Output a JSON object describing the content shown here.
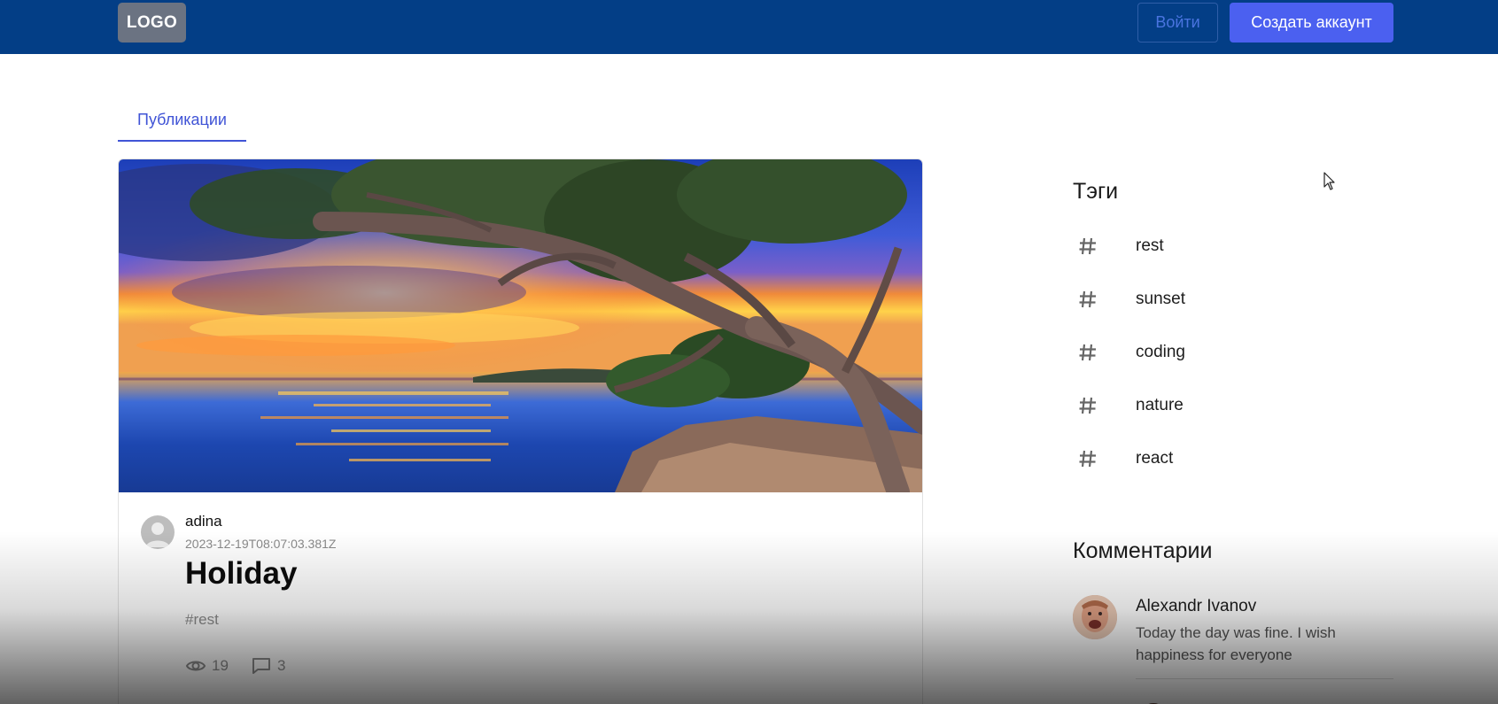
{
  "header": {
    "logo": "LOGO",
    "login_label": "Войти",
    "signup_label": "Создать аккаунт"
  },
  "tabs": [
    {
      "label": "Публикации",
      "active": true
    }
  ],
  "post": {
    "author": "adina",
    "date": "2023-12-19T08:07:03.381Z",
    "title": "Holiday",
    "tag": "#rest",
    "views": "19",
    "comments": "3"
  },
  "sidebar": {
    "tags_title": "Тэги",
    "tags": [
      {
        "label": "rest",
        "icon": "hash-icon"
      },
      {
        "label": "sunset",
        "icon": "hash-icon"
      },
      {
        "label": "coding",
        "icon": "hash-icon"
      },
      {
        "label": "nature",
        "icon": "hash-icon"
      },
      {
        "label": "react",
        "icon": "hash-icon"
      }
    ],
    "comments_title": "Комментарии",
    "comments": [
      {
        "name": "Alexandr Ivanov",
        "text": "Today the day was fine. I wish happiness for everyone"
      }
    ]
  },
  "colors": {
    "header_bg": "#033e86",
    "accent": "#4054d6",
    "signup_bg": "#4b60f0"
  }
}
